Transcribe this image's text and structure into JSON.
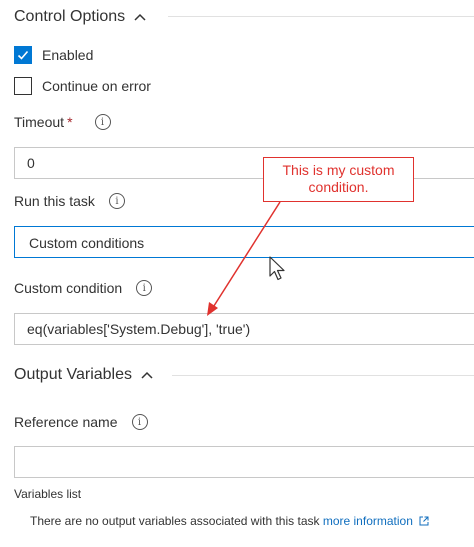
{
  "control_options": {
    "title": "Control Options",
    "enabled_label": "Enabled",
    "enabled_checked": true,
    "continue_on_error_label": "Continue on error",
    "continue_on_error_checked": false,
    "timeout_label": "Timeout",
    "timeout_required_mark": "*",
    "timeout_value": "0",
    "run_task_label": "Run this task",
    "run_task_value": "Custom conditions",
    "custom_condition_label": "Custom condition",
    "custom_condition_value": "eq(variables['System.Debug'], 'true')"
  },
  "annotation": {
    "line1": "This is my custom",
    "line2": "condition.",
    "color": "#e0322e"
  },
  "output_variables": {
    "title": "Output Variables",
    "reference_name_label": "Reference name",
    "reference_name_value": "",
    "variables_list_label": "Variables list",
    "empty_message": "There are no output variables associated with this task",
    "more_info_link": "more information"
  },
  "icons": {
    "chevron": "chevron-up-icon",
    "info": "info-icon",
    "external_link": "external-link-icon",
    "checkmark": "checkmark-icon",
    "cursor": "mouse-pointer-icon"
  },
  "colors": {
    "accent": "#0078d4",
    "link": "#106ebe",
    "required": "#a4262c",
    "annotation": "#e0322e"
  }
}
